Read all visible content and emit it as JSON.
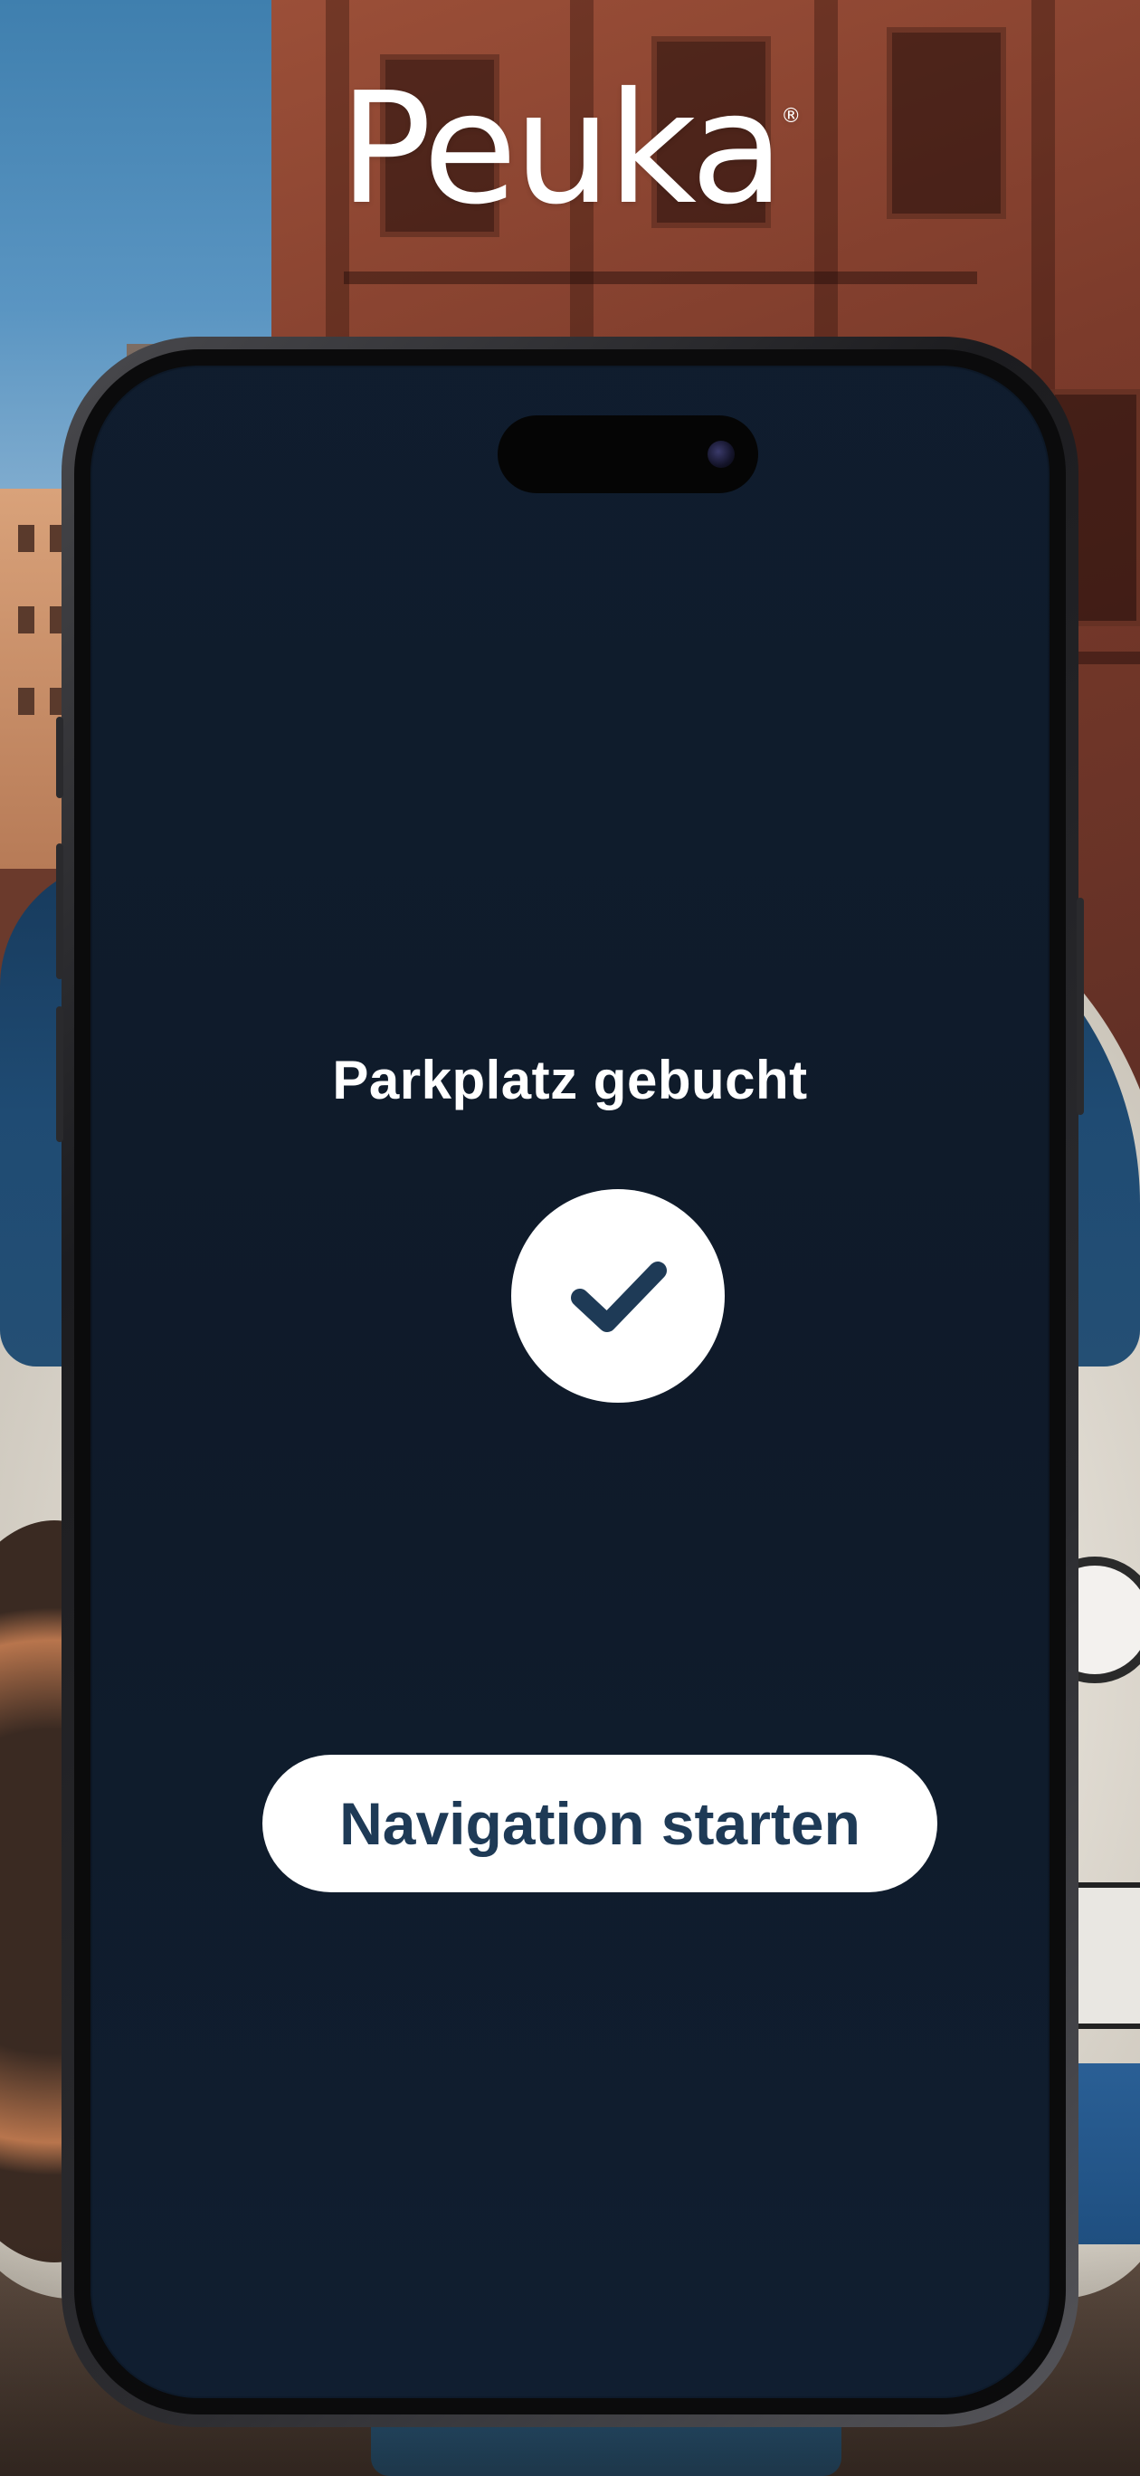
{
  "brand": {
    "logo_text": "Peuka",
    "registered_mark": "®"
  },
  "screen": {
    "title": "Parkplatz gebucht",
    "success_icon": "checkmark-icon",
    "primary_action_label": "Navigation starten"
  },
  "colors": {
    "button_text": "#1e3a56",
    "check_icon": "#1e3a56",
    "overlay_tint": "#14264a",
    "white": "#ffffff"
  }
}
